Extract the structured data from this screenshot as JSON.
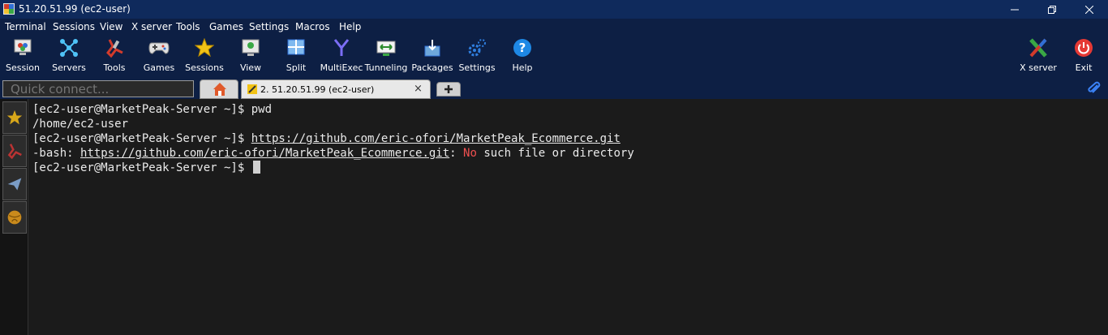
{
  "window": {
    "title": "51.20.51.99 (ec2-user)"
  },
  "menu": [
    "Terminal",
    "Sessions",
    "View",
    "X server",
    "Tools",
    "Games",
    "Settings",
    "Macros",
    "Help"
  ],
  "toolbar": {
    "session": "Session",
    "servers": "Servers",
    "tools": "Tools",
    "games": "Games",
    "sessions": "Sessions",
    "view": "View",
    "split": "Split",
    "multiexec": "MultiExec",
    "tunneling": "Tunneling",
    "packages": "Packages",
    "settings": "Settings",
    "help": "Help",
    "xserver": "X server",
    "exit": "Exit"
  },
  "quick_connect": {
    "placeholder": "Quick connect..."
  },
  "tabs": {
    "session_tab": "2. 51.20.51.99 (ec2-user)",
    "close": "×"
  },
  "terminal": {
    "line1": {
      "prompt": "[ec2-user@MarketPeak-Server ~]$ ",
      "cmd": "pwd"
    },
    "line2": {
      "out": "/home/ec2-user"
    },
    "line3": {
      "prompt": "[ec2-user@MarketPeak-Server ~]$ ",
      "cmd": "https://github.com/eric-ofori/MarketPeak_Ecommerce.git"
    },
    "line4": {
      "pre": "-bash: ",
      "url": "https://github.com/eric-ofori/MarketPeak_Ecommerce.git",
      "colon": ": ",
      "no": "No",
      "rest": " such file or directory"
    },
    "line5": {
      "prompt": "[ec2-user@MarketPeak-Server ~]$ "
    }
  },
  "colors": {
    "titlebar": "#0f2a5c",
    "toolbar": "#0d1f44",
    "terminal_bg": "#1b1b1b",
    "error_red": "#ef4f4f"
  }
}
